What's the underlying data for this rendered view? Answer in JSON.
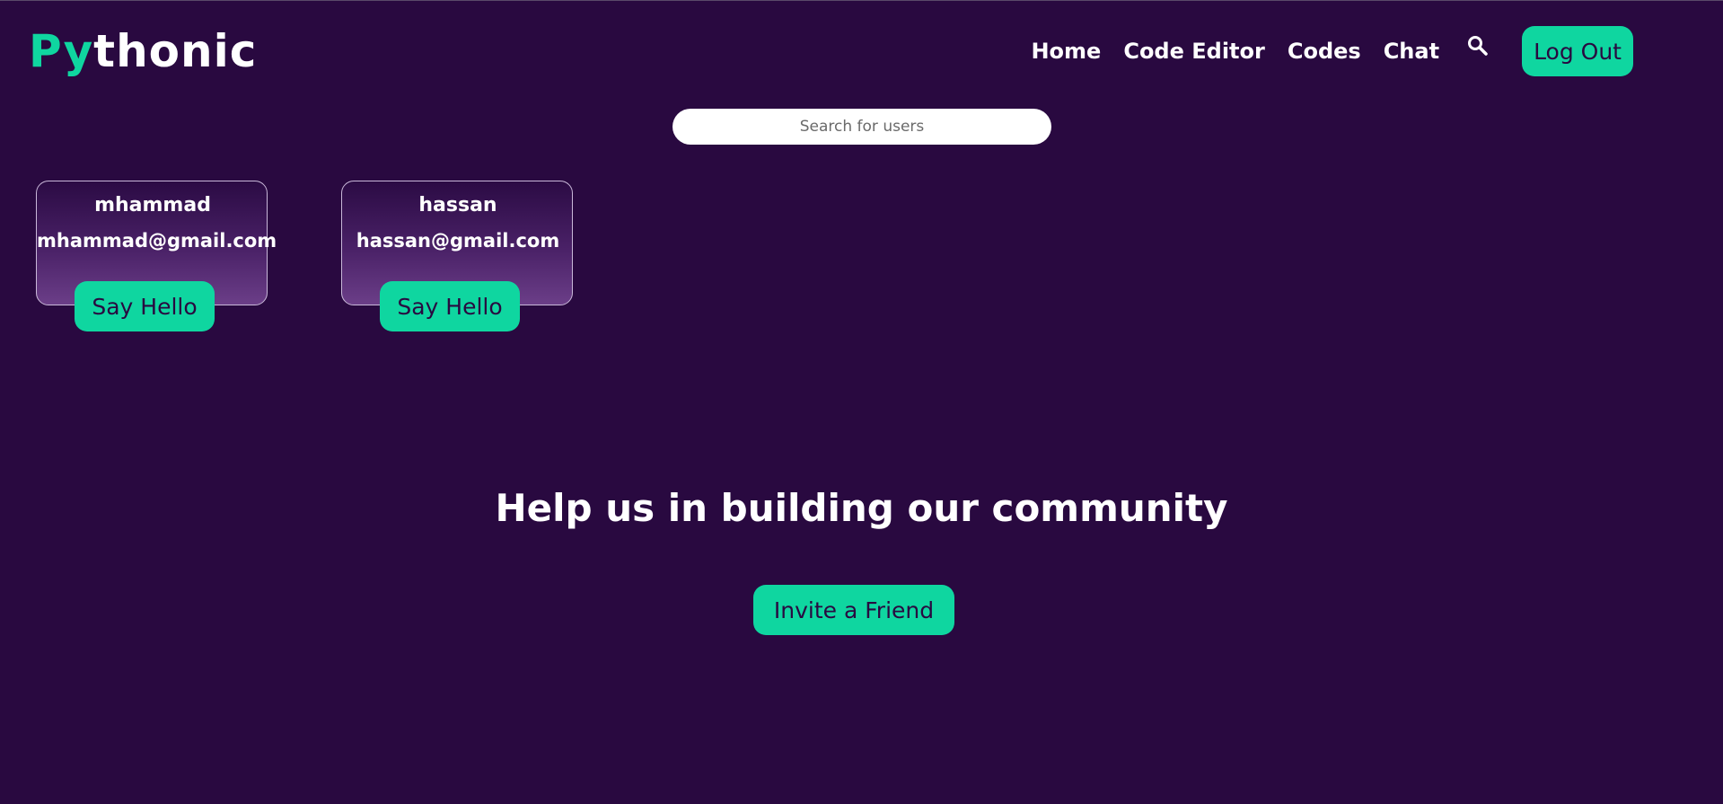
{
  "header": {
    "logo_accent": "Py",
    "logo_rest": "thonic",
    "nav": [
      {
        "label": "Home"
      },
      {
        "label": "Code Editor"
      },
      {
        "label": "Codes"
      },
      {
        "label": "Chat"
      }
    ],
    "search_icon": "search-icon",
    "logout_label": "Log Out"
  },
  "search": {
    "placeholder": "Search for users",
    "value": ""
  },
  "users": [
    {
      "username": "mhammad",
      "email": "mhammad@gmail.com",
      "button_label": "Say Hello"
    },
    {
      "username": "hassan",
      "email": "hassan@gmail.com",
      "button_label": "Say Hello"
    }
  ],
  "community": {
    "title": "Help us in building our community",
    "invite_label": "Invite a Friend"
  },
  "colors": {
    "background": "#290940",
    "accent": "#0fd6a0",
    "text": "#ffffff",
    "button_text": "#290940"
  }
}
